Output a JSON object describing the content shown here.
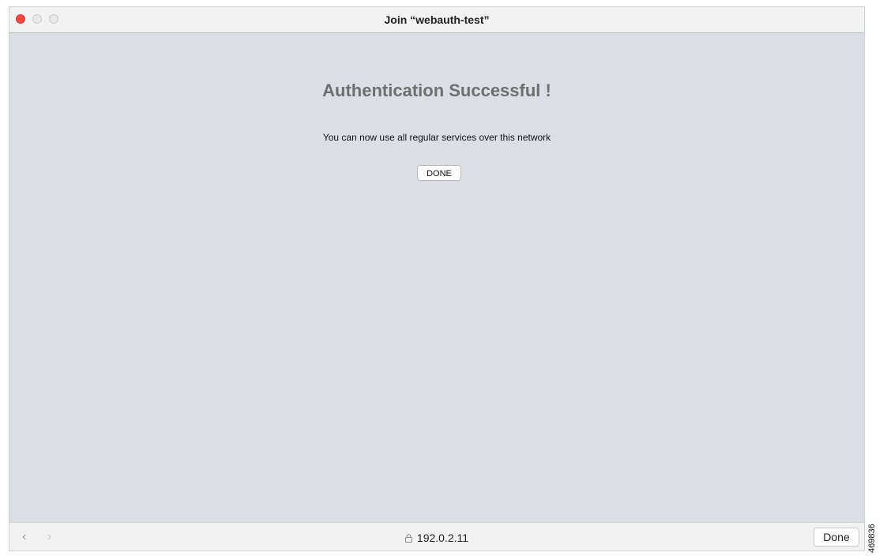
{
  "window": {
    "title": "Join “webauth-test”"
  },
  "page": {
    "heading": "Authentication Successful !",
    "message": "You can now use all regular services over this network",
    "done_button_label": "DONE"
  },
  "bottom_bar": {
    "back_icon": "chevron-left-icon",
    "forward_icon": "chevron-right-icon",
    "lock_icon": "lock-icon",
    "url": "192.0.2.11",
    "done_label": "Done"
  },
  "figure_id": "469836",
  "colors": {
    "close_button": "#ee4a42",
    "content_background": "#dcdee6",
    "heading": "#6e6e6e"
  }
}
